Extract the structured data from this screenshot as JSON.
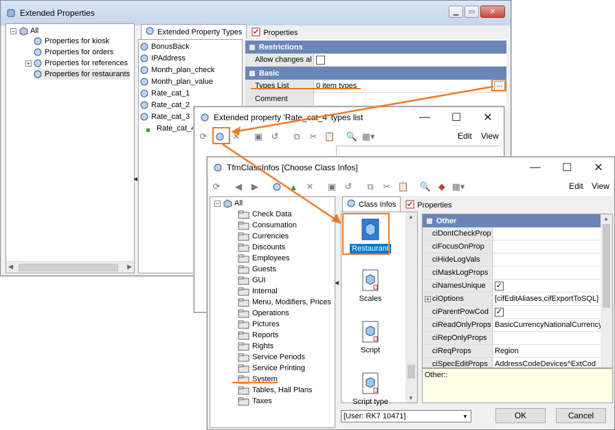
{
  "colors": {
    "accent": "#f07a22",
    "group_header": "#6a86b8",
    "selection": "#0078d7"
  },
  "w1": {
    "title": "Extended Properties",
    "tree": {
      "root": "All",
      "items": [
        "Properties for kiosk",
        "Properties for orders",
        "Properties for references",
        "Properties for restaurants"
      ]
    },
    "list": [
      "BonusBack",
      "IPAddress",
      "Month_plan_check",
      "Month_plan_value",
      "Rate_cat_1",
      "Rate_cat_2",
      "Rate_cat_3",
      "Rate_cat_4"
    ],
    "tabs": [
      "Extended Property Types",
      "Properties"
    ],
    "groups": {
      "restrictions": "Restrictions",
      "basic": "Basic"
    },
    "props": {
      "allow_changes": {
        "name": "Allow changes al",
        "checked": false
      },
      "types_list": {
        "name": "Types List",
        "value": "0 item types",
        "ellipsis": "···"
      },
      "comment": {
        "name": "Comment",
        "value": ""
      }
    }
  },
  "w2": {
    "title": "Extended property 'Rate_cat_4' types list",
    "menu": {
      "edit": "Edit",
      "view": "View"
    }
  },
  "w3": {
    "title": "TfmClassInfos [Choose Class Infos]",
    "menu": {
      "edit": "Edit",
      "view": "View"
    },
    "tree": {
      "root": "All",
      "items": [
        "Check Data",
        "Consumation",
        "Currencies",
        "Discounts",
        "Employees",
        "Guests",
        "GUI",
        "Internal",
        "Menu, Modifiers, Prices",
        "Operations",
        "Pictures",
        "Reports",
        "Rights",
        "Service Periods",
        "Service Printing",
        "System",
        "Tables, Hall Plans",
        "Taxes"
      ]
    },
    "tabs": [
      "Class Infos",
      "Properties"
    ],
    "icons": [
      "Restaurant",
      "Scales",
      "Script",
      "Script type"
    ],
    "group": "Other",
    "props": [
      {
        "name": "ciDontCheckProp",
        "value": ""
      },
      {
        "name": "ciFocusOnProp",
        "value": ""
      },
      {
        "name": "ciHideLogVals",
        "value": ""
      },
      {
        "name": "ciMaskLogProps",
        "value": ""
      },
      {
        "name": "ciNamesUnique",
        "value": "☑"
      },
      {
        "name": "ciOptions",
        "value": "[cifEditAliases,cifExportToSQL]"
      },
      {
        "name": "ciParentPowCod",
        "value": "☑"
      },
      {
        "name": "ciReadOnlyProps",
        "value": "BasicCurrencyNationalCurrency"
      },
      {
        "name": "ciRepOnlyProps",
        "value": ""
      },
      {
        "name": "ciReqProps",
        "value": "Region"
      },
      {
        "name": "ciSpecEditProps",
        "value": "AddressCodeDevices^ExtCod"
      }
    ],
    "desc": "Other::",
    "user_combo": "[User: RK7 10471]",
    "ok": "OK",
    "cancel": "Cancel"
  }
}
